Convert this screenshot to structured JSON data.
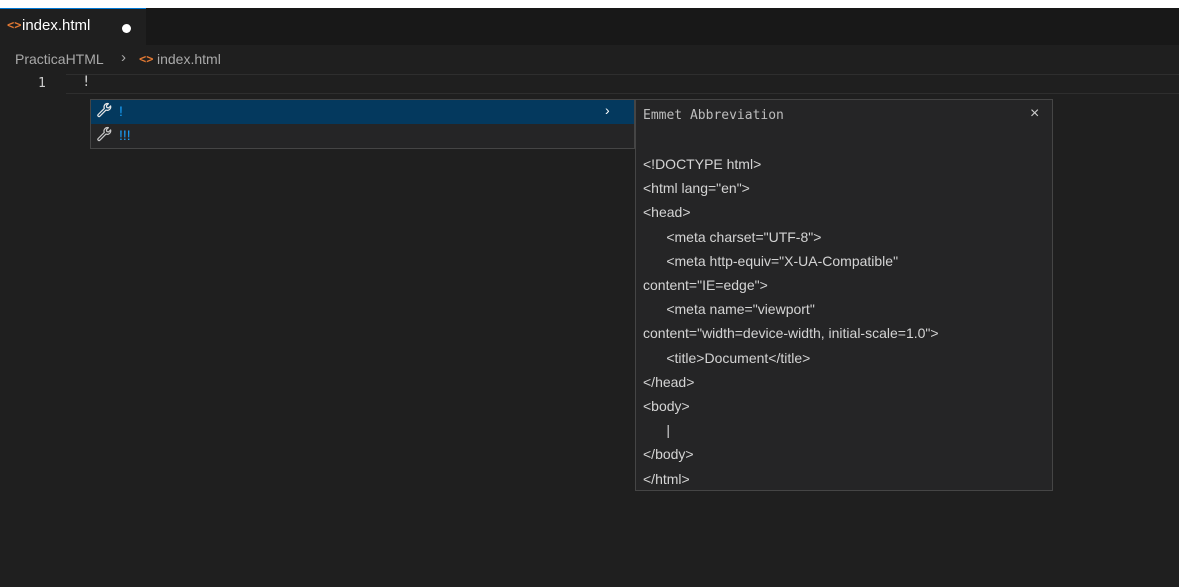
{
  "tab": {
    "icon": "html-file-icon",
    "label": "index.html",
    "dirty": true
  },
  "breadcrumb": {
    "folder": "PracticaHTML",
    "separator": "›",
    "file_icon": "html-file-icon",
    "file": "index.html"
  },
  "editor": {
    "line_number": "1",
    "line_text": "!"
  },
  "suggest": {
    "items": [
      {
        "icon": "wrench-snippet-icon",
        "label": "!",
        "selected": true
      },
      {
        "icon": "wrench-snippet-icon",
        "label": "!!!",
        "selected": false
      }
    ],
    "chevron": "›"
  },
  "details": {
    "title": "Emmet Abbreviation",
    "close": "×",
    "lines": [
      "<!DOCTYPE html>",
      "<html lang=\"en\">",
      "<head>",
      "      <meta charset=\"UTF-8\">",
      "      <meta http-equiv=\"X-UA-Compatible\"",
      "content=\"IE=edge\">",
      "      <meta name=\"viewport\"",
      "content=\"width=device-width, initial-scale=1.0\">",
      "      <title>Document</title>",
      "</head>",
      "<body>",
      "      |",
      "</body>",
      "</html>"
    ]
  },
  "colors": {
    "editor_bg": "#1f1f1f",
    "tabbar_bg": "#181818",
    "selection": "#04395e",
    "accent_blue": "#18a3ff",
    "html_icon": "#e37933"
  }
}
